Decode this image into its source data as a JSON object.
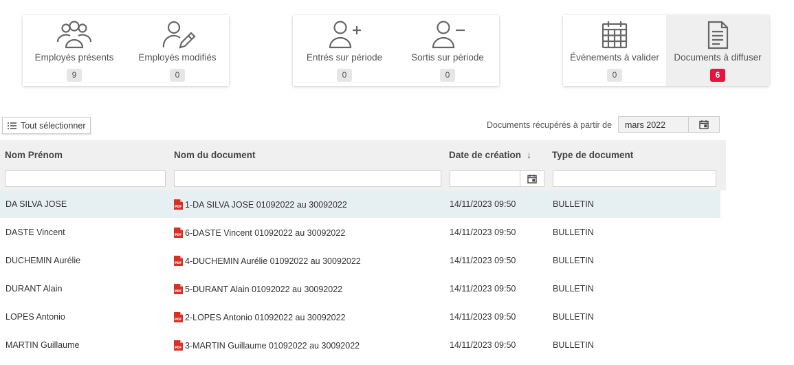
{
  "cards": [
    {
      "tiles": [
        {
          "icon": "users-icon",
          "label": "Employés présents",
          "count": "9"
        },
        {
          "icon": "user-edit-icon",
          "label": "Employés modifiés",
          "count": "0"
        }
      ]
    },
    {
      "tiles": [
        {
          "icon": "user-plus-icon",
          "label": "Entrés sur période",
          "count": "0"
        },
        {
          "icon": "user-minus-icon",
          "label": "Sortis sur période",
          "count": "0"
        }
      ]
    },
    {
      "tiles": [
        {
          "icon": "calendar-icon",
          "label": "Événements à valider",
          "count": "0"
        },
        {
          "icon": "document-icon",
          "label": "Documents à diffuser",
          "count": "6",
          "highlight": true
        }
      ]
    }
  ],
  "toolbar": {
    "select_all_label": "Tout sélectionner",
    "date_label": "Documents récupérés à partir de",
    "date_value": "mars 2022"
  },
  "table": {
    "columns": [
      "Nom Prénom",
      "Nom du document",
      "Date de création",
      "Type de document"
    ],
    "sort_indicator": "↓",
    "rows": [
      {
        "name": "DA SILVA JOSE",
        "document": "1-DA SILVA JOSE 01092022 au 30092022",
        "date": "14/11/2023 09:50",
        "type": "BULLETIN"
      },
      {
        "name": "DASTE Vincent",
        "document": "6-DASTE Vincent 01092022 au 30092022",
        "date": "14/11/2023 09:50",
        "type": "BULLETIN"
      },
      {
        "name": "DUCHEMIN Aurélie",
        "document": "4-DUCHEMIN Aurélie 01092022 au 30092022",
        "date": "14/11/2023 09:50",
        "type": "BULLETIN"
      },
      {
        "name": "DURANT Alain",
        "document": "5-DURANT Alain 01092022 au 30092022",
        "date": "14/11/2023 09:50",
        "type": "BULLETIN"
      },
      {
        "name": "LOPES Antonio",
        "document": "2-LOPES Antonio 01092022 au 30092022",
        "date": "14/11/2023 09:50",
        "type": "BULLETIN"
      },
      {
        "name": "MARTIN Guillaume",
        "document": "3-MARTIN Guillaume 01092022 au 30092022",
        "date": "14/11/2023 09:50",
        "type": "BULLETIN"
      }
    ]
  },
  "colors": {
    "accent_red": "#e8123c",
    "selected_row": "#e6eff2",
    "header_bg": "#f0f0f0"
  }
}
